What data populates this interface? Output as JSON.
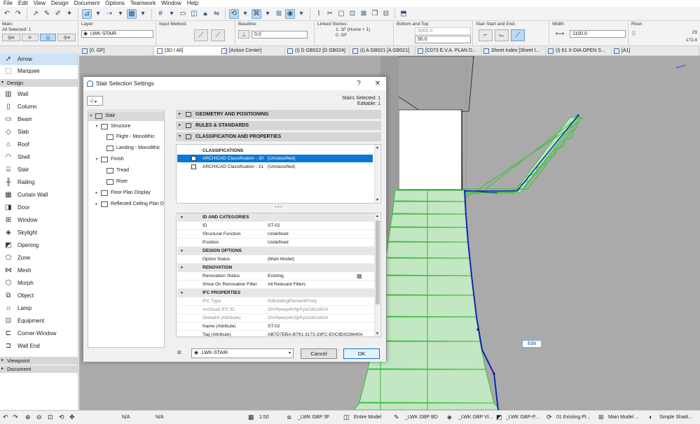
{
  "menu": [
    "File",
    "Edit",
    "View",
    "Design",
    "Document",
    "Options",
    "Teamwork",
    "Window",
    "Help"
  ],
  "infobox": {
    "main_label": "Main:",
    "selected_label": "All Selected: 1",
    "layer_label": "Layer:",
    "layer_value": "LWK-STAIR",
    "input_label": "Input Method:",
    "baseline_label": "Baseline:",
    "baseline_value": "0.0",
    "linked_label": "Linked Stories:",
    "linked_top": "1. 1F (Home + 1)",
    "linked_bottom": "0. GF",
    "bottom_top_label": "Bottom and Top:",
    "top_value": "5000.0",
    "bottom_value": "50.0",
    "stair_start_label": "Stair Start and End:",
    "width_label": "Width:",
    "width_value": "1100.0",
    "riser_label": "Riser:",
    "riser_count": "29",
    "riser_height": "172.4"
  },
  "tabs": [
    {
      "label": "[0. GF]"
    },
    {
      "label": "[3D / All]"
    },
    {
      "label": "[Action Center]"
    },
    {
      "label": "(I) D GB022 [D GB024]"
    },
    {
      "label": "(I) A GB021 [A GB021]"
    },
    {
      "label": "[C073 E.V.A. PLAN D..."
    },
    {
      "label": "Sheet Index [Sheet I..."
    },
    {
      "label": "(I) 61 X-DIA OPEN S..."
    },
    {
      "label": "[A1]"
    }
  ],
  "toolbox": {
    "top_items": [
      {
        "label": "Arrow",
        "icon": "arrow-icon"
      },
      {
        "label": "Marquee",
        "icon": "marquee-icon"
      }
    ],
    "design_header": "Design",
    "design_items": [
      {
        "label": "Wall",
        "icon": "wall-icon"
      },
      {
        "label": "Column",
        "icon": "column-icon"
      },
      {
        "label": "Beam",
        "icon": "beam-icon"
      },
      {
        "label": "Slab",
        "icon": "slab-icon"
      },
      {
        "label": "Roof",
        "icon": "roof-icon"
      },
      {
        "label": "Shell",
        "icon": "shell-icon"
      },
      {
        "label": "Stair",
        "icon": "stair-icon"
      },
      {
        "label": "Railing",
        "icon": "railing-icon"
      },
      {
        "label": "Curtain Wall",
        "icon": "curtain-wall-icon"
      },
      {
        "label": "Door",
        "icon": "door-icon"
      },
      {
        "label": "Window",
        "icon": "window-icon"
      },
      {
        "label": "Skylight",
        "icon": "skylight-icon"
      },
      {
        "label": "Opening",
        "icon": "opening-icon"
      },
      {
        "label": "Zone",
        "icon": "zone-icon"
      },
      {
        "label": "Mesh",
        "icon": "mesh-icon"
      },
      {
        "label": "Morph",
        "icon": "morph-icon"
      },
      {
        "label": "Object",
        "icon": "object-icon"
      },
      {
        "label": "Lamp",
        "icon": "lamp-icon"
      },
      {
        "label": "Equipment",
        "icon": "equipment-icon"
      },
      {
        "label": "Corner-Window",
        "icon": "corner-window-icon"
      },
      {
        "label": "Wall End",
        "icon": "wall-end-icon"
      }
    ],
    "viewpoint_header": "Viewpoint",
    "document_header": "Document"
  },
  "dialog": {
    "title": "Stair Selection Settings",
    "help": "?",
    "close": "✕",
    "stairs_selected": "Stairs Selected: 1",
    "editable": "Editable: 1",
    "favorites_icon": "☆",
    "tree": [
      {
        "label": "Stair",
        "level": 0
      },
      {
        "label": "Structure",
        "level": 1
      },
      {
        "label": "Flight - Monolithic",
        "level": 2
      },
      {
        "label": "Landing - Monolithic",
        "level": 2
      },
      {
        "label": "Finish",
        "level": 1
      },
      {
        "label": "Tread",
        "level": 2
      },
      {
        "label": "Riser",
        "level": 2
      },
      {
        "label": "Floor Plan Display",
        "level": 1
      },
      {
        "label": "Reflected Ceiling Plan Di",
        "level": 1
      }
    ],
    "panels": [
      {
        "label": "GEOMETRY AND POSITIONING"
      },
      {
        "label": "RULES & STANDARDS"
      },
      {
        "label": "CLASSIFICATION AND PROPERTIES"
      }
    ],
    "classifications_header": "CLASSIFICATIONS",
    "classifications": [
      {
        "label": "ARCHICAD Classification - 20",
        "value": "(Unclassified)",
        "selected": true
      },
      {
        "label": "ARCHICAD Classification - 21",
        "value": "(Unclassified)",
        "selected": false
      }
    ],
    "params": [
      {
        "k": "ID AND CATEGORIES",
        "v": "",
        "type": "group"
      },
      {
        "k": "ID",
        "v": "ST-02",
        "type": "row"
      },
      {
        "k": "Structural Function",
        "v": "Undefined",
        "type": "row"
      },
      {
        "k": "Position",
        "v": "Undefined",
        "type": "row"
      },
      {
        "k": "DESIGN OPTIONS",
        "v": "",
        "type": "group"
      },
      {
        "k": "Option Status",
        "v": "(Main Model)",
        "type": "row"
      },
      {
        "k": "RENOVATION",
        "v": "",
        "type": "group"
      },
      {
        "k": "Renovation Status",
        "v": "Existing",
        "type": "row"
      },
      {
        "k": "Show On Renovation Filter",
        "v": "All Relevant Filters",
        "type": "row"
      },
      {
        "k": "IFC PROPERTIES",
        "v": "",
        "type": "group"
      },
      {
        "k": "IFC Type",
        "v": "IfcBuildingElementProxy",
        "type": "dim"
      },
      {
        "k": "Archicad IFC ID",
        "v": "2hVNwwjv4nSpFyuCdGo6GA",
        "type": "dim"
      },
      {
        "k": "GlobalId (Attribute)",
        "v": "2hVNwwjv4nSpFyuCdGo6GA",
        "type": "dim"
      },
      {
        "k": "Name (Attribute)",
        "v": "ST-02",
        "type": "row"
      },
      {
        "k": "Tag (Attribute)",
        "v": "AB7D7EBA-B791-3173-33FC-E0C9D0C8640A",
        "type": "row"
      }
    ],
    "layer_value": "LWK-STAIR",
    "cancel": "Cancel",
    "ok": "OK"
  },
  "viewport": {
    "edit_tip": "Edit"
  },
  "statusbar": {
    "na1": "N/A",
    "na2": "N/A",
    "scale": "1:50",
    "layer_combo": "_LWK GBP 3F",
    "model": "Entire Model",
    "pen": "_LWK GBP BD",
    "view": "_LWK GBP VI...",
    "view2": "_LWK GBP-P...",
    "reno": "01 Existing Pl...",
    "model_view": "Main Model ...",
    "shading": "Simple Shadi..."
  },
  "colors": {
    "selection": "#0a78d7",
    "stair_green": "#3fd23f",
    "stair_outline": "#0b26b5"
  }
}
